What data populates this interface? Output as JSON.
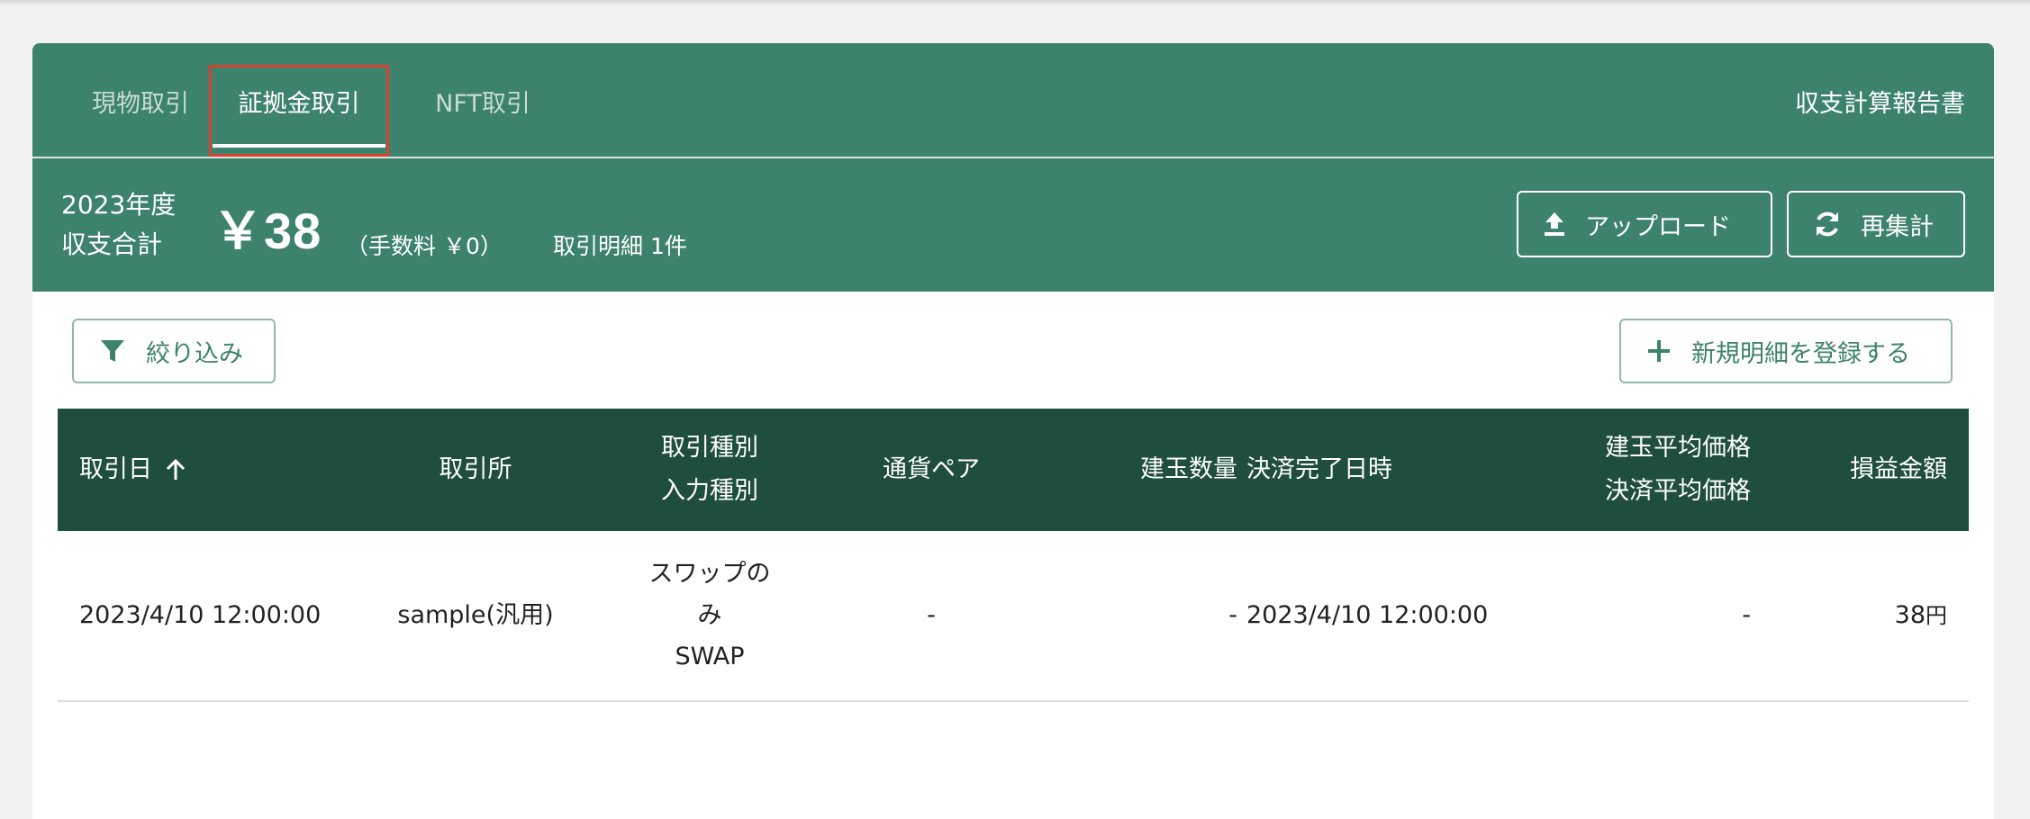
{
  "tabs": [
    {
      "label": "現物取引",
      "active": false
    },
    {
      "label": "証拠金取引",
      "active": true
    },
    {
      "label": "NFT取引",
      "active": false
    }
  ],
  "report_link": "収支計算報告書",
  "summary": {
    "year": "2023年度",
    "total_label": "収支合計",
    "total_amount": "￥38",
    "fee": "（手数料 ￥0）",
    "count": "取引明細 1件"
  },
  "buttons": {
    "upload": "アップロード",
    "recalc": "再集計",
    "filter": "絞り込み",
    "add_new": "新規明細を登録する"
  },
  "table": {
    "headers": {
      "date": "取引日",
      "exchange": "取引所",
      "type_1": "取引種別",
      "type_2": "入力種別",
      "pair": "通貨ペア",
      "position_qty": "建玉数量",
      "settled_at": "決済完了日時",
      "avg_price_1": "建玉平均価格",
      "avg_price_2": "決済平均価格",
      "pnl": "損益金額"
    },
    "rows": [
      {
        "date": "2023/4/10 12:00:00",
        "exchange": "sample(汎用)",
        "type_line1": "スワップの",
        "type_line2": "み",
        "input_type": "SWAP",
        "pair": "-",
        "position_qty": "-",
        "settled_at": "2023/4/10 12:00:00",
        "avg_price": "-",
        "pnl_value": "38",
        "pnl_unit": "円"
      }
    ]
  },
  "colors": {
    "primary": "#3d826c",
    "table_header": "#1f4d3e",
    "highlight": "#d9412f"
  }
}
